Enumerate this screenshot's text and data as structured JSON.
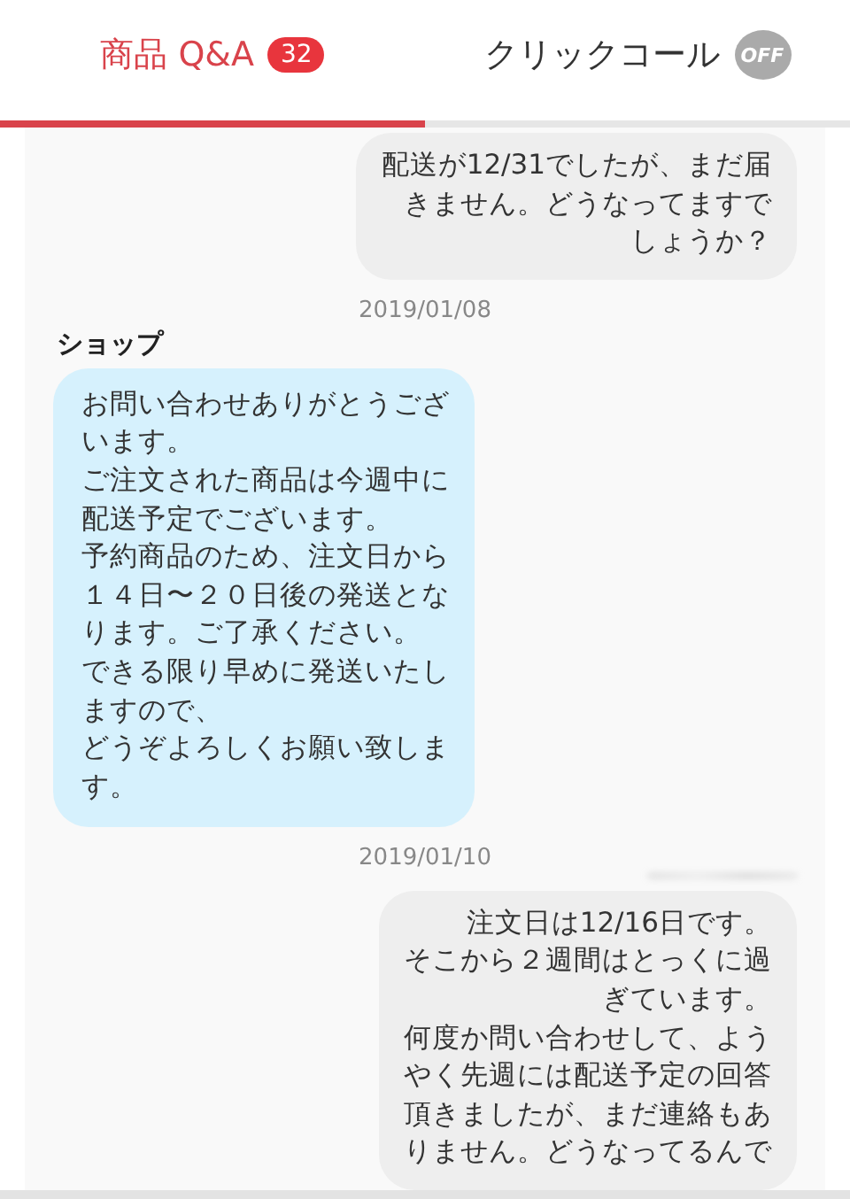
{
  "tabs": [
    {
      "label": "商品 Q&A",
      "badge": "32",
      "selected": true
    },
    {
      "label": "クリックコール",
      "toggle": {
        "label": "OFF",
        "on": false
      },
      "selected": false
    }
  ],
  "messages": [
    {
      "kind": "customer_message",
      "lines": [
        "配送が12/31でしたが、まだ届",
        "きません。どうなってますで",
        "しょうか？"
      ]
    },
    {
      "kind": "date",
      "text": "2019/01/08"
    },
    {
      "kind": "shop_message",
      "sender": "ショップ",
      "lines": [
        "お問い合わせありがとうござ",
        "います。",
        "ご注文された商品は今週中に",
        "配送予定でございます。",
        "予約商品のため、注文日から",
        "１４日〜２０日後の発送とな",
        "ります。ご了承ください。",
        "できる限り早めに発送いたし",
        "ますので、",
        "どうぞよろしくお願い致しま",
        "す。"
      ]
    },
    {
      "kind": "date",
      "text": "2019/01/10"
    },
    {
      "kind": "hidden_sender"
    },
    {
      "kind": "customer_message",
      "lines": [
        "注文日は12/16日です。",
        "そこから２週間はとっくに過",
        "ぎています。",
        "何度か問い合わせして、よう",
        "やく先週には配送予定の回答",
        "頂きましたが、まだ連絡もあ",
        "りません。どうなってるんで"
      ]
    }
  ]
}
